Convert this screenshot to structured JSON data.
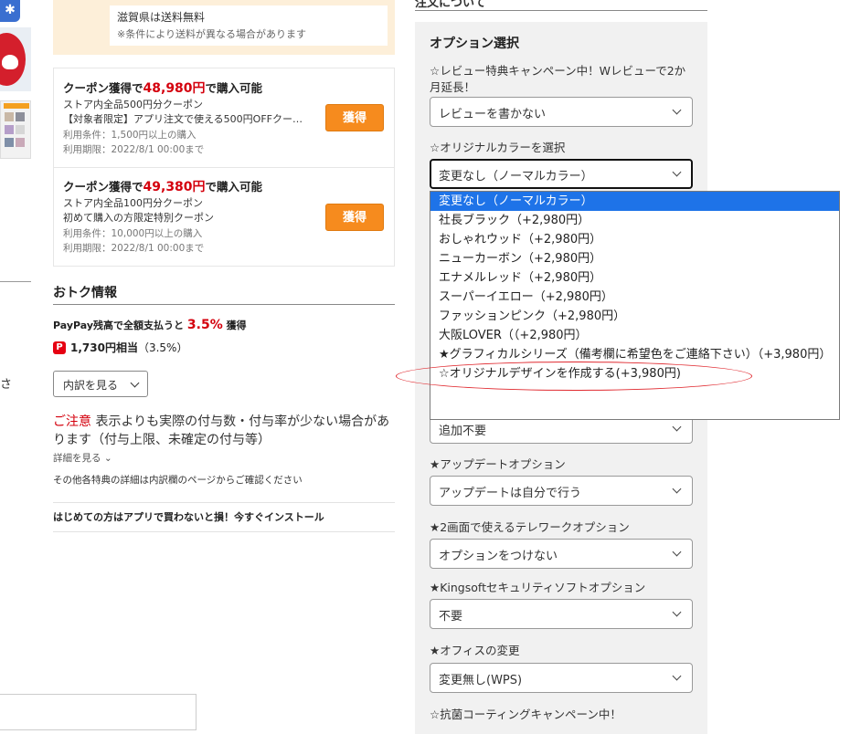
{
  "shipping": {
    "line1": "滋賀県は送料無料",
    "line2": "※条件により送料が異なる場合があります"
  },
  "coupons": [
    {
      "title_prefix": "クーポン獲得で",
      "price": "48,980円",
      "title_suffix": "で購入可能",
      "desc1": "ストア内全品500円分クーポン",
      "desc2": "【対象者限定】アプリ注文で使える500円OFFクー…",
      "cond": "利用条件：1,500円以上の購入",
      "period": "利用期限：2022/8/1 00:00まで",
      "button": "獲得"
    },
    {
      "title_prefix": "クーポン獲得で",
      "price": "49,380円",
      "title_suffix": "で購入可能",
      "desc1": "ストア内全品100円分クーポン",
      "desc2": "初めて購入の方限定特別クーポン",
      "cond": "利用条件：10,000円以上の購入",
      "period": "利用期限：2022/8/1 00:00まで",
      "button": "獲得"
    }
  ],
  "otoku": {
    "title": "おトク情報",
    "paypay_prefix": "PayPay残高で全額支払うと",
    "paypay_pct": "3.5%",
    "paypay_suffix": "獲得",
    "pp_icon": "P",
    "amount": "1,730円相当",
    "amount_pct": "（3.5%）",
    "breakdown_btn": "内訳を見る",
    "caution_head": "ご注意",
    "caution_body": " 表示よりも実際の付与数・付与率が少ない場合があります（付与上限、未確定の付与等）",
    "detail_link": "詳細を見る ⌄",
    "other_note": "その他各特典の詳細は内訳欄のページからご確認ください",
    "app_line": "はじめての方はアプリで買わないと損！今すぐインストール"
  },
  "left": {
    "sa": "さ",
    "bt_icon": "✱"
  },
  "options": {
    "header_cut": "注文について",
    "title": "オプション選択",
    "review_label": "☆レビュー特典キャンペーン中！Wレビューで2か月延長！",
    "review_value": "レビューを書かない",
    "color_label": "☆オリジナルカラーを選択",
    "color_value": "変更なし（ノーマルカラー）",
    "color_options": [
      "変更なし（ノーマルカラー）",
      "社長ブラック（+2,980円）",
      "おしゃれウッド（+2,980円）",
      "ニューカーボン（+2,980円）",
      "エナメルレッド（+2,980円）",
      "スーパーイエロー（+2,980円）",
      "ファッションピンク（+2,980円）",
      "大阪LOVER（（+2,980円）",
      "★グラフィカルシリーズ（備考欄に希望色をご連絡下さい）（+3,980円）",
      "☆オリジナルデザインを作成する(+3,980円)"
    ],
    "hidden_select_value": "追加不要",
    "update_label": "★アップデートオプション",
    "update_value": "アップデートは自分で行う",
    "telework_label": "★2画面で使えるテレワークオプション",
    "telework_value": "オプションをつけない",
    "kingsoft_label": "★Kingsoftセキュリティソフトオプション",
    "kingsoft_value": "不要",
    "office_label": "★オフィスの変更",
    "office_value": "変更無し(WPS)",
    "antibac_label": "☆抗菌コーティングキャンペーン中！"
  },
  "colors": {
    "accent_orange": "#f68b1e",
    "price_red": "#d4000d",
    "dropdown_highlight": "#1e73e8",
    "annotation_red": "#e0282e",
    "panel_bg": "#f1f1f1",
    "shipping_bg": "#fdefd9"
  }
}
